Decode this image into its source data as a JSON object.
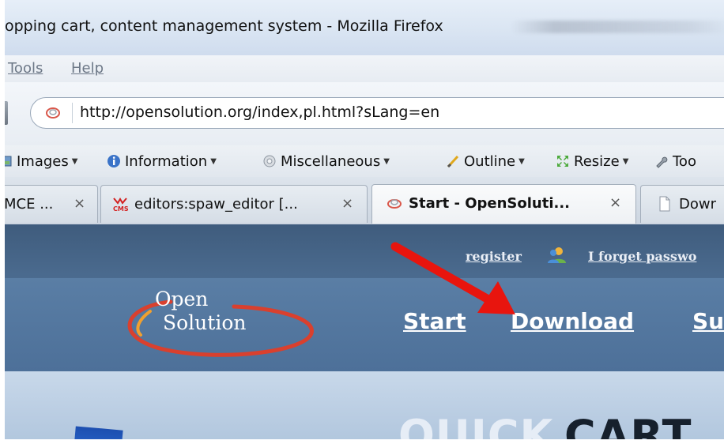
{
  "window": {
    "title": "opping cart, content management system - Mozilla Firefox"
  },
  "menubar": {
    "tools": "Tools",
    "help": "Help"
  },
  "navbar": {
    "url": "http://opensolution.org/index,pl.html?sLang=en"
  },
  "devtoolbar": {
    "items": [
      {
        "label": "Images",
        "icon": "images-icon"
      },
      {
        "label": "Information",
        "icon": "info-icon"
      },
      {
        "label": "Miscellaneous",
        "icon": "miscellaneous-icon"
      },
      {
        "label": "Outline",
        "icon": "outline-icon"
      },
      {
        "label": "Resize",
        "icon": "resize-icon"
      },
      {
        "label": "Too",
        "icon": "tools-icon"
      }
    ]
  },
  "tabs": [
    {
      "label": "MCE ...",
      "close": "×"
    },
    {
      "label": "editors:spaw_editor [...",
      "close": "×"
    },
    {
      "label": "Start - OpenSoluti...",
      "close": "×",
      "active": true
    },
    {
      "label": "Dowr"
    }
  ],
  "site": {
    "top_links": {
      "register": "register",
      "forgot": "I forget passwo"
    },
    "logo": {
      "line1": "Open",
      "line2": "Solution"
    },
    "nav": {
      "start": "Start",
      "download": "Download",
      "partial": "Su"
    },
    "banner": {
      "part1": "QUICK",
      "part2": "CART"
    }
  },
  "colors": {
    "site_header": "#4d7099",
    "site_topstrip": "#3f5c7d",
    "arrow": "#e8150e"
  }
}
